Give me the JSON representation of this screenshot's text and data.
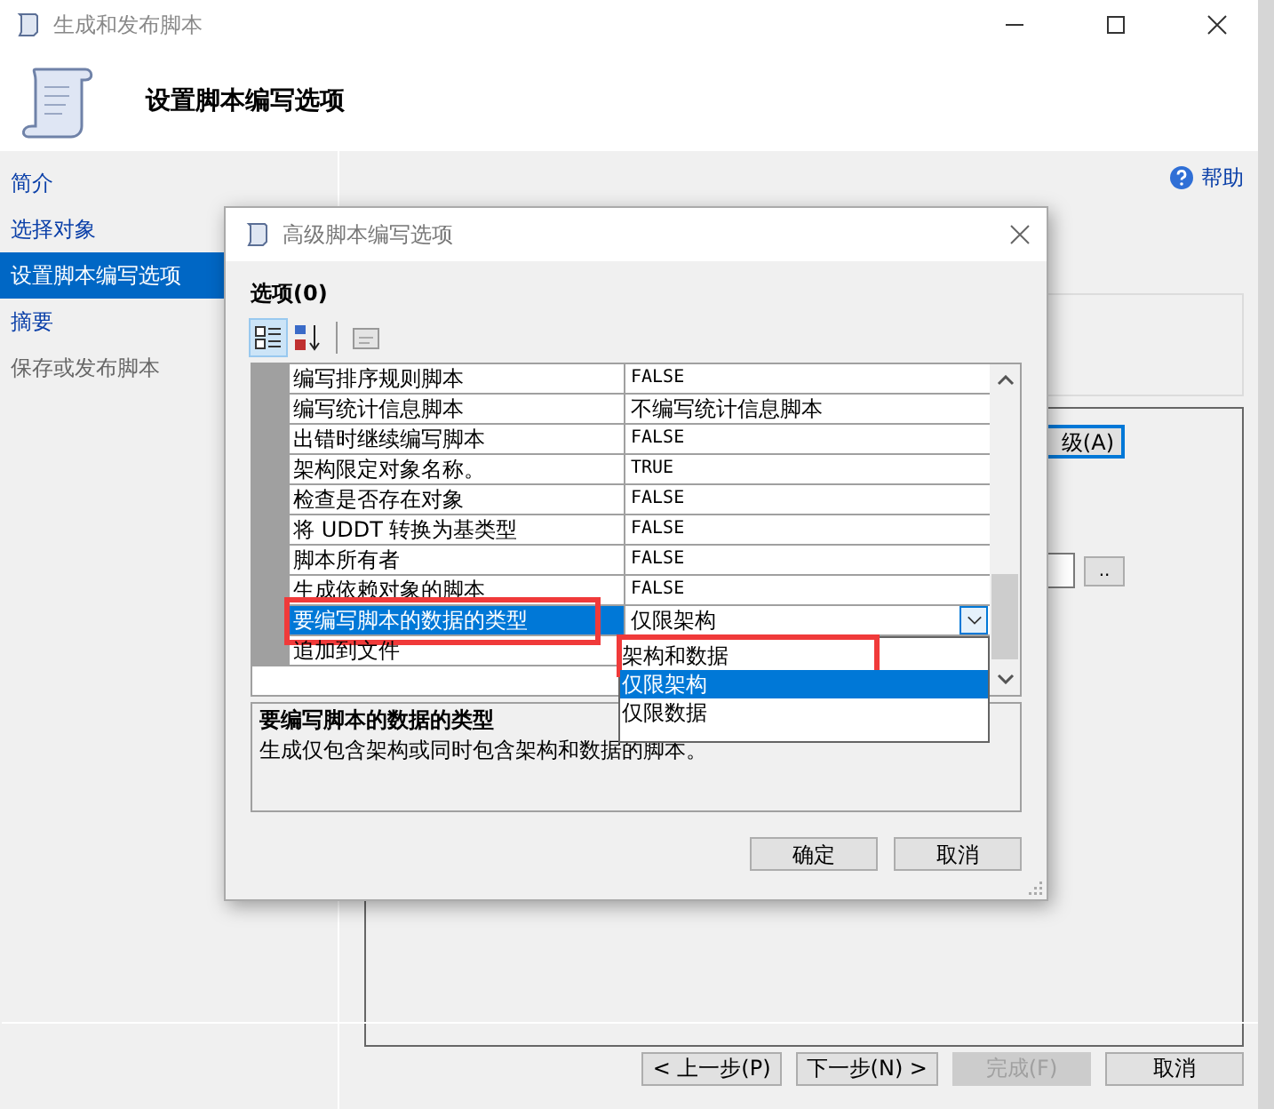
{
  "window": {
    "title": "生成和发布脚本",
    "header": "设置脚本编写选项"
  },
  "sidebar": {
    "items": [
      {
        "label": "简介",
        "selected": false,
        "disabled": false
      },
      {
        "label": "选择对象",
        "selected": false,
        "disabled": false
      },
      {
        "label": "设置脚本编写选项",
        "selected": true,
        "disabled": false
      },
      {
        "label": "摘要",
        "selected": false,
        "disabled": false
      },
      {
        "label": "保存或发布脚本",
        "selected": false,
        "disabled": true
      }
    ]
  },
  "help_link": "帮助",
  "content": {
    "advanced_button": "级(A)",
    "browse_button": ".."
  },
  "wizard_buttons": [
    {
      "label": "< 上一步(P)",
      "disabled": false
    },
    {
      "label": "下一步(N) >",
      "disabled": false
    },
    {
      "label": "完成(F)",
      "disabled": true
    },
    {
      "label": "取消",
      "disabled": false
    }
  ],
  "dialog": {
    "title": "高级脚本编写选项",
    "section_label": "选项(0)",
    "options": [
      {
        "name": "编写排序规则脚本",
        "value": "FALSE",
        "selected": false,
        "highlighted": false
      },
      {
        "name": "编写统计信息脚本",
        "value": "不编写统计信息脚本",
        "selected": false,
        "highlighted": false
      },
      {
        "name": "出错时继续编写脚本",
        "value": "FALSE",
        "selected": false,
        "highlighted": false
      },
      {
        "name": "架构限定对象名称。",
        "value": "TRUE",
        "selected": false,
        "highlighted": false
      },
      {
        "name": "检查是否存在对象",
        "value": "FALSE",
        "selected": false,
        "highlighted": false
      },
      {
        "name": "将 UDDT 转换为基类型",
        "value": "FALSE",
        "selected": false,
        "highlighted": false
      },
      {
        "name": "脚本所有者",
        "value": "FALSE",
        "selected": false,
        "highlighted": false
      },
      {
        "name": "生成依赖对象的脚本",
        "value": "FALSE",
        "selected": false,
        "highlighted": false
      },
      {
        "name": "要编写脚本的数据的类型",
        "value": "仅限架构",
        "selected": true,
        "highlighted": true
      },
      {
        "name": "追加到文件",
        "selected": false,
        "highlighted": false
      }
    ],
    "dropdown": {
      "items": [
        {
          "label": "架构和数据",
          "selected": false,
          "highlighted": true
        },
        {
          "label": "仅限架构",
          "selected": true,
          "highlighted": false
        },
        {
          "label": "仅限数据",
          "selected": false,
          "highlighted": false
        }
      ]
    },
    "description": {
      "title": "要编写脚本的数据的类型",
      "text": "生成仅包含架构或同时包含架构和数据的脚本。"
    },
    "buttons": [
      "确定",
      "取消"
    ]
  }
}
